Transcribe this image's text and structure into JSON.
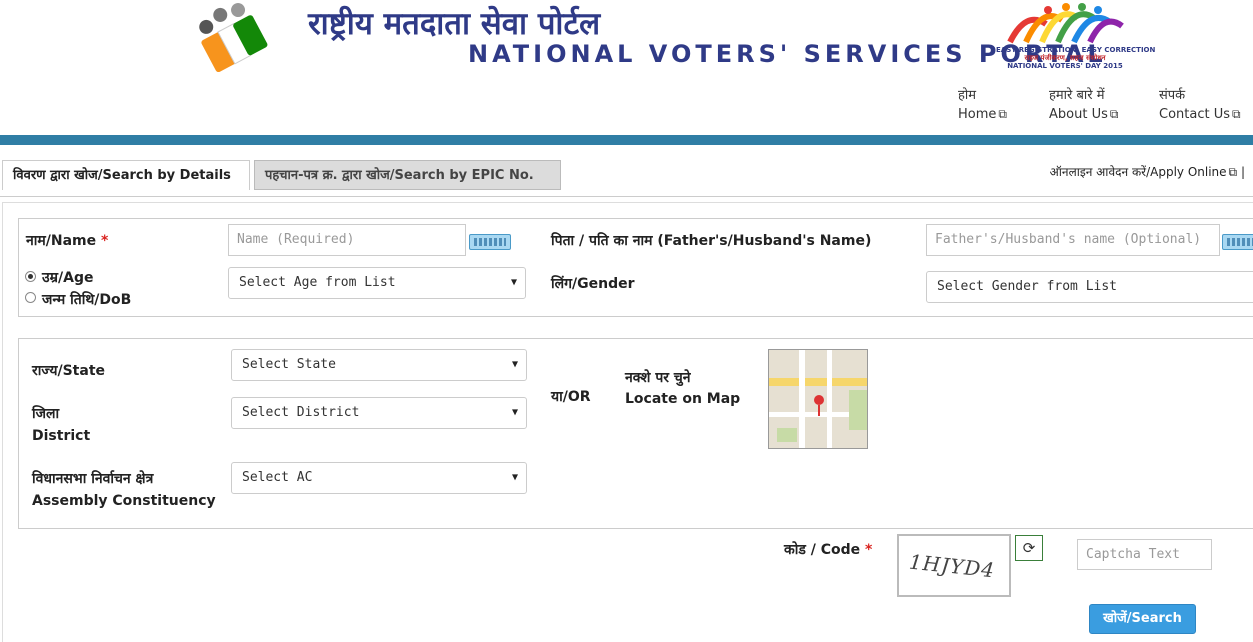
{
  "header": {
    "title_hi": "राष्ट्रीय मतदाता सेवा पोर्टल",
    "title_en": "NATIONAL VOTERS' SERVICES PORTAL",
    "tagline_line1": "EASY REGISTRATION, EASY CORRECTION",
    "tagline_line2": "सहज पंजीकरण, सहज संशोधन",
    "tagline_line3": "NATIONAL VOTERS' DAY 2015",
    "brand_color": "#2f3a87",
    "bar_color": "#2f7ea5"
  },
  "nav": [
    {
      "hi": "होम",
      "en": "Home"
    },
    {
      "hi": "हमारे बारे में",
      "en": "About Us"
    },
    {
      "hi": "संपर्क",
      "en": "Contact Us"
    }
  ],
  "tabs": [
    {
      "label": "विवरण द्वारा खोज/Search by Details",
      "active": true
    },
    {
      "label": "पहचान-पत्र क्र. द्वारा खोज/Search by EPIC No.",
      "active": false
    }
  ],
  "apply_online": "ऑनलाइन आवेदन करें/Apply Online",
  "apply_separator": "|",
  "form": {
    "name_label": "नाम/Name",
    "required_mark": "*",
    "name_placeholder": "Name (Required)",
    "father_label": "पिता / पति का नाम (Father's/Husband's Name)",
    "father_placeholder": "Father's/Husband's name (Optional)",
    "age_label": "उम्र/Age",
    "dob_label": "जन्म तिथि/DoB",
    "age_select": "Select Age from List",
    "gender_label": "लिंग/Gender",
    "gender_select": "Select Gender from List",
    "state_label": "राज्य/State",
    "state_select": "Select State",
    "district_label_hi": "जिला",
    "district_label_en": "District",
    "district_select": "Select District",
    "ac_label_hi": "विधानसभा निर्वाचन क्षेत्र",
    "ac_label_en": "Assembly Constituency",
    "ac_select": "Select AC",
    "or_label": "या/OR",
    "map_label_hi": "नक्शे पर चुने",
    "map_label_en": "Locate on Map",
    "code_label": "कोड / Code",
    "captcha_text": "1HJYD4",
    "captcha_placeholder": "Captcha Text",
    "search_button": "खोजें/Search"
  },
  "icons": {
    "external_link": "external-link-icon",
    "keyboard": "keyboard-icon",
    "refresh": "refresh-icon",
    "caret": "caret-down-icon"
  },
  "colors": {
    "button_bg": "#3a9de0",
    "required": "#d9231f"
  }
}
